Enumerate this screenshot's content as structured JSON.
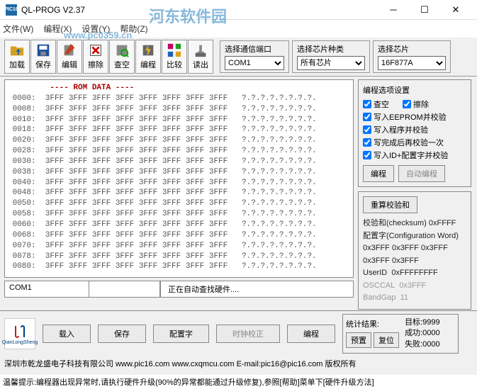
{
  "title": "QL-PROG V2.37",
  "watermark1": "河东软件园",
  "watermark2": "www.pc0359.cn",
  "menu": [
    "文件(W)",
    "编程(X)",
    "设置(Y)",
    "帮助(Z)"
  ],
  "toolbar": [
    "加载",
    "保存",
    "编辑",
    "擦除",
    "查空",
    "编程",
    "比较",
    "读出"
  ],
  "selects": {
    "port": {
      "label": "选择通信端口",
      "value": "COM1"
    },
    "kind": {
      "label": "选择芯片种类",
      "value": "所有芯片"
    },
    "chip": {
      "label": "选择芯片",
      "value": "16F877A"
    }
  },
  "rom_header": "---- ROM DATA ----",
  "rom_rows": [
    "0000:",
    "0008:",
    "0010:",
    "0018:",
    "0020:",
    "0028:",
    "0030:",
    "0038:",
    "0040:",
    "0048:",
    "0050:",
    "0058:",
    "0060:",
    "0068:",
    "0070:",
    "0078:",
    "0080:"
  ],
  "rom_val": "3FFF",
  "ascii": "?.?.?.?.?.?.?.?.",
  "status": {
    "port": "COM1",
    "msg": "正在自动查找硬件...."
  },
  "opts": {
    "title": "编程选项设置",
    "check_blank": "查空",
    "erase": "擦除",
    "eeprom": "写入EEPROM并校验",
    "program": "写入程序并校验",
    "verify": "写完成后再校验一次",
    "idconfig": "写入ID+配置字并校验",
    "btn_prog": "编程",
    "btn_auto": "自动编程"
  },
  "calc": {
    "btn": "重算校验和",
    "checksum_l": "校验和(checksum)",
    "checksum_v": "0xFFFF",
    "config_l": "配置字(Configuration Word)",
    "config_v": "0x3FFF 0x3FFF 0x3FFF",
    "config_v2": "0x3FFF 0x3FFF",
    "userid_l": "UserID",
    "userid_v": "0xFFFFFFFF",
    "osccal_l": "OSCCAL",
    "osccal_v": "0x3FFF",
    "bandgap_l": "BandGap",
    "bandgap_v": "11"
  },
  "foot": {
    "load": "载入",
    "save": "保存",
    "config": "配置字",
    "clock": "时钟校正",
    "prog": "编程",
    "preset": "预置",
    "reset": "复位"
  },
  "stat": {
    "title": "统计结果:",
    "target_l": "目标:",
    "target_v": "9999",
    "ok_l": "成功:",
    "ok_v": "0000",
    "fail_l": "失败:",
    "fail_v": "0000"
  },
  "qianlong": "QianLongSheng",
  "copyright": "深圳市乾龙盛电子科技有限公司 www.pic16.com www.cxqmcu.com E-mail:pic16@pic16.com 版权所有",
  "hint": "温馨提示:编程器出现异常时,请执行硬件升级(90%的异常都能通过升级修复),参照[帮助]菜单下[硬件升级方法]"
}
